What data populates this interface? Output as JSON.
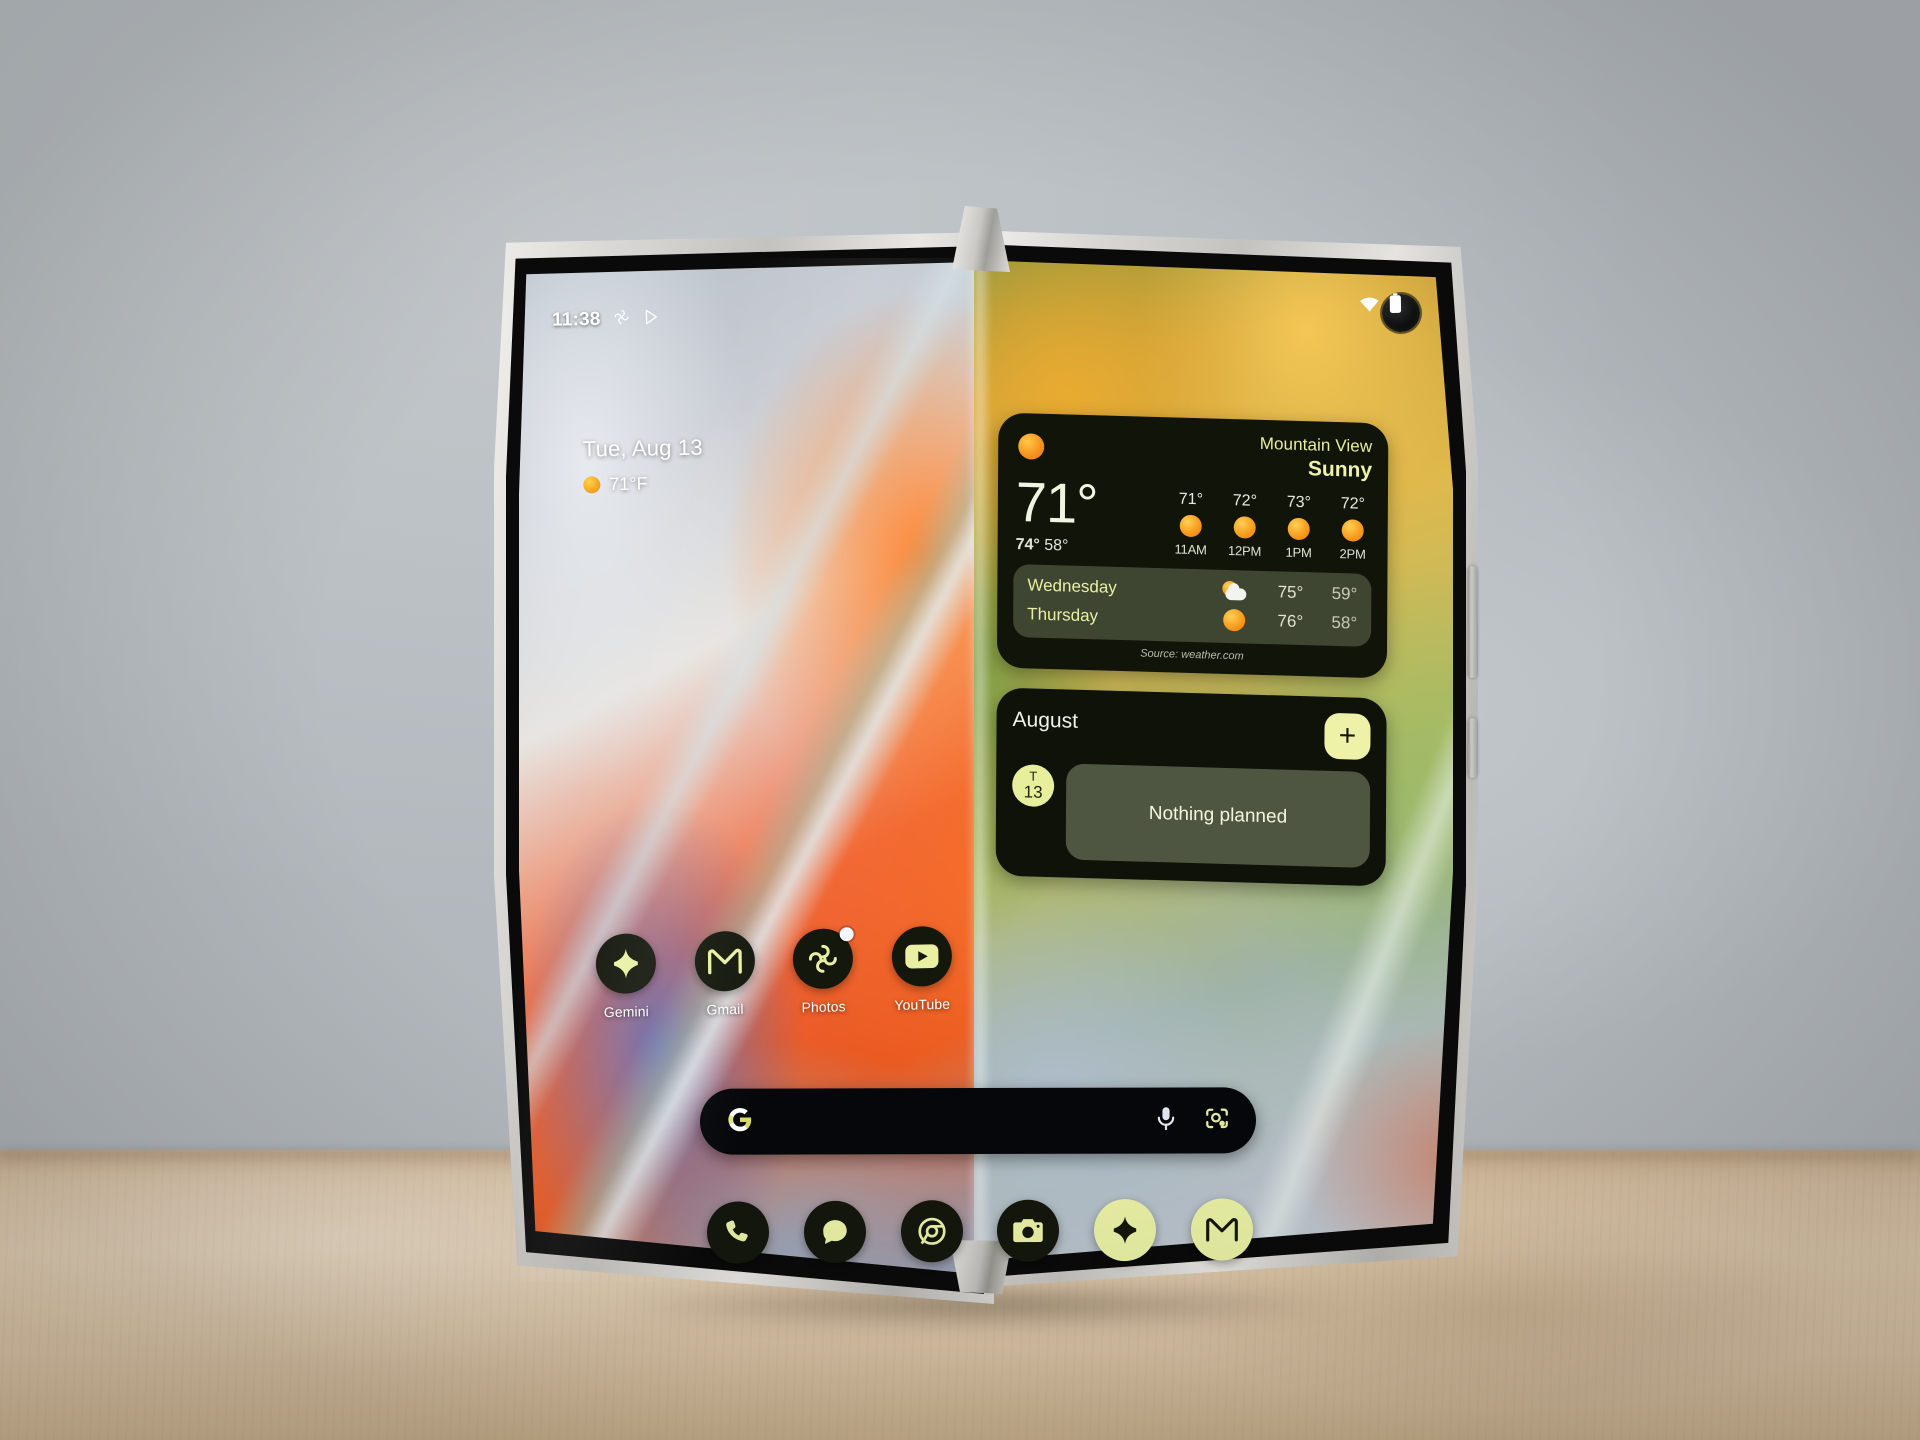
{
  "device": {
    "name": "foldable-phone",
    "form": "open-book-fold"
  },
  "status_bar": {
    "time": "11:38",
    "left_icons": [
      "photos-icon",
      "play-store-icon"
    ],
    "right_icons": [
      "wifi-icon",
      "battery-icon"
    ]
  },
  "at_a_glance": {
    "date": "Tue, Aug 13",
    "temperature": "71°F",
    "weather_icon": "sun-icon"
  },
  "weather_widget": {
    "icon": "sun-icon",
    "city": "Mountain View",
    "condition": "Sunny",
    "current_temp": "71°",
    "high": "74°",
    "low": "58°",
    "hourly": [
      {
        "temp": "71°",
        "icon": "sun-icon",
        "label": "11AM"
      },
      {
        "temp": "72°",
        "icon": "sun-icon",
        "label": "12PM"
      },
      {
        "temp": "73°",
        "icon": "sun-icon",
        "label": "1PM"
      },
      {
        "temp": "72°",
        "icon": "sun-icon",
        "label": "2PM"
      }
    ],
    "daily": [
      {
        "day": "Wednesday",
        "icon": "sun-behind-cloud-icon",
        "high": "75°",
        "low": "59°"
      },
      {
        "day": "Thursday",
        "icon": "sun-icon",
        "high": "76°",
        "low": "58°"
      }
    ],
    "source": "Source: weather.com",
    "accent_color": "#e8ef9a",
    "background_color": "#111409"
  },
  "calendar_widget": {
    "month": "August",
    "add_label": "+",
    "day_letter": "T",
    "day_number": "13",
    "event_text": "Nothing planned",
    "accent_color": "#eef2a9",
    "background_color": "#0e1208"
  },
  "app_row": [
    {
      "label": "Gemini",
      "icon": "gemini-icon"
    },
    {
      "label": "Gmail",
      "icon": "gmail-icon"
    },
    {
      "label": "Photos",
      "icon": "photos-icon",
      "badge": true
    },
    {
      "label": "YouTube",
      "icon": "youtube-icon"
    }
  ],
  "search_bar": {
    "logo": "google-g-icon",
    "mic": "microphone-icon",
    "lens": "google-lens-icon"
  },
  "dock": [
    {
      "label": "Phone",
      "icon": "phone-icon",
      "inverted": false
    },
    {
      "label": "Messages",
      "icon": "messages-icon",
      "inverted": false
    },
    {
      "label": "Chrome",
      "icon": "chrome-icon",
      "inverted": false
    },
    {
      "label": "Camera",
      "icon": "camera-icon",
      "inverted": false
    },
    {
      "label": "Gemini",
      "icon": "gemini-icon",
      "inverted": true
    },
    {
      "label": "Gmail",
      "icon": "gmail-icon",
      "inverted": true
    }
  ],
  "theme": {
    "icon_bg": "#14170c",
    "icon_fg": "#e9f0a4",
    "text": "#ffffff"
  }
}
